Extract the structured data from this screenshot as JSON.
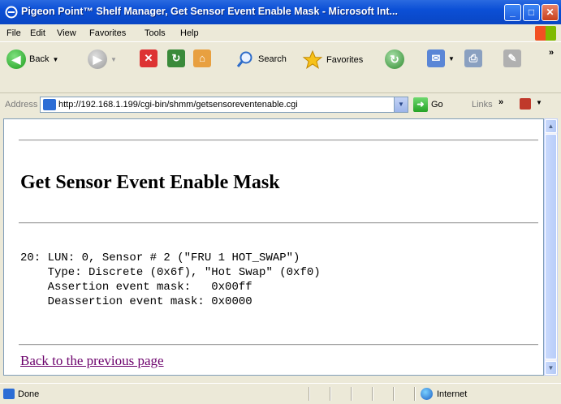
{
  "window": {
    "title": "Pigeon Point™ Shelf Manager, Get Sensor Event Enable Mask - Microsoft Int...",
    "controls": {
      "minimize": "_",
      "maximize": "□",
      "close": "✕"
    }
  },
  "menubar": {
    "items": [
      "File",
      "Edit",
      "View",
      "Favorites",
      "Tools",
      "Help"
    ]
  },
  "toolbar": {
    "back": "Back",
    "search": "Search",
    "favorites": "Favorites"
  },
  "address": {
    "label": "Address",
    "url": "http://192.168.1.199/cgi-bin/shmm/getsensoreventenable.cgi",
    "go": "Go",
    "links": "Links"
  },
  "page": {
    "heading": "Get Sensor Event Enable Mask",
    "output_lines": [
      "20: LUN: 0, Sensor # 2 (\"FRU 1 HOT_SWAP\")",
      "    Type: Discrete (0x6f), \"Hot Swap\" (0xf0)",
      "    Assertion event mask:   0x00ff",
      "    Deassertion event mask: 0x0000"
    ],
    "back_link": "Back to the previous page"
  },
  "statusbar": {
    "status": "Done",
    "zone": "Internet"
  }
}
